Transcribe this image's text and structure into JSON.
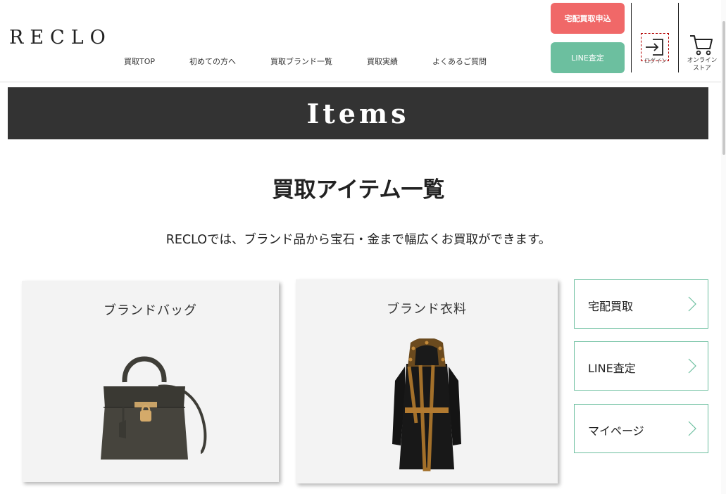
{
  "header": {
    "logo": "RECLO",
    "nav": [
      {
        "label": "買取TOP"
      },
      {
        "label": "初めての方へ"
      },
      {
        "label": "買取ブランド一覧"
      },
      {
        "label": "買取実績"
      },
      {
        "label": "よくあるご質問"
      }
    ],
    "apply_button": "宅配買取申込",
    "line_button": "LINE査定",
    "login_label": "ログイン",
    "store_label_line1": "オンライン",
    "store_label_line2": "ストア",
    "icons": {
      "login": "login-icon",
      "cart": "cart-icon"
    },
    "colors": {
      "apply": "#f06868",
      "line": "#6cbf9f"
    }
  },
  "banner": {
    "title": "Items"
  },
  "page": {
    "title": "買取アイテム一覧",
    "lead": "RECLOでは、ブランド品から宝石・金まで幅広くお買取ができます。"
  },
  "cards": [
    {
      "title": "ブランドバッグ",
      "image": "handbag"
    },
    {
      "title": "ブランド衣料",
      "image": "coat"
    }
  ],
  "side_links": [
    {
      "label": "宅配買取"
    },
    {
      "label": "LINE査定"
    },
    {
      "label": "マイページ"
    }
  ]
}
